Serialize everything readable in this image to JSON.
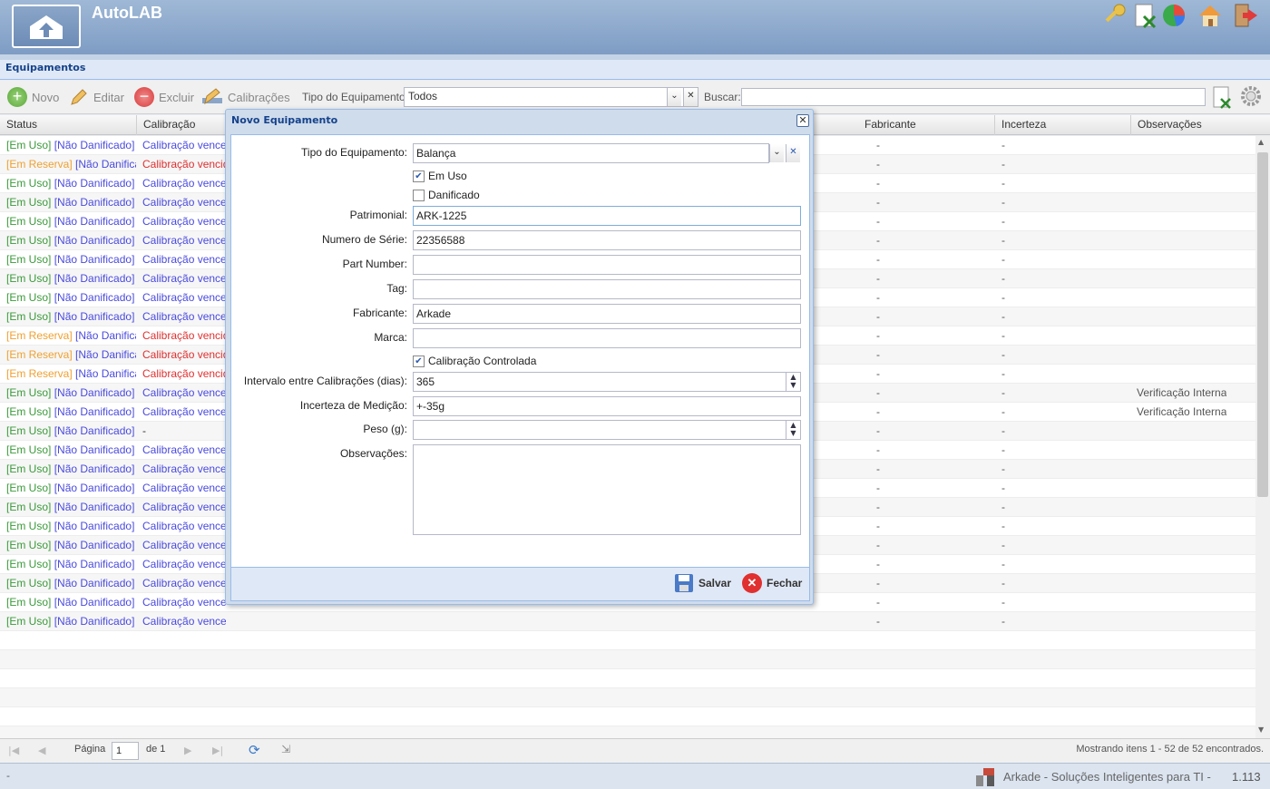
{
  "app": {
    "title": "AutoLAB"
  },
  "panel": {
    "title": "Equipamentos"
  },
  "toolbar": {
    "novo": "Novo",
    "editar": "Editar",
    "excluir": "Excluir",
    "calibracoes": "Calibrações",
    "tipo_label": "Tipo do Equipamento:",
    "tipo_value": "Todos",
    "buscar_label": "Buscar:"
  },
  "grid": {
    "headers": {
      "status": "Status",
      "calibracao": "Calibração",
      "fabricante": "Fabricante",
      "incerteza": "Incerteza",
      "observacoes": "Observações"
    },
    "rows": [
      {
        "s1": "[Em Uso]",
        "s2": "[Não Danificado]",
        "cal": "Calibração vencerá",
        "fab": "-",
        "inc": "-",
        "obs": ""
      },
      {
        "s1": "[Em Reserva]",
        "s2": "[Não Danificado]",
        "cal": "Calibração vencida",
        "fab": "-",
        "inc": "-",
        "obs": ""
      },
      {
        "s1": "[Em Uso]",
        "s2": "[Não Danificado]",
        "cal": "Calibração vencerá",
        "fab": "-",
        "inc": "-",
        "obs": ""
      },
      {
        "s1": "[Em Uso]",
        "s2": "[Não Danificado]",
        "cal": "Calibração vencerá",
        "fab": "-",
        "inc": "-",
        "obs": ""
      },
      {
        "s1": "[Em Uso]",
        "s2": "[Não Danificado]",
        "cal": "Calibração vencerá",
        "fab": "-",
        "inc": "-",
        "obs": ""
      },
      {
        "s1": "[Em Uso]",
        "s2": "[Não Danificado]",
        "cal": "Calibração vencerá",
        "fab": "-",
        "inc": "-",
        "obs": ""
      },
      {
        "s1": "[Em Uso]",
        "s2": "[Não Danificado]",
        "cal": "Calibração vencerá",
        "fab": "-",
        "inc": "-",
        "obs": ""
      },
      {
        "s1": "[Em Uso]",
        "s2": "[Não Danificado]",
        "cal": "Calibração vencerá",
        "fab": "-",
        "inc": "-",
        "obs": ""
      },
      {
        "s1": "[Em Uso]",
        "s2": "[Não Danificado]",
        "cal": "Calibração vencerá",
        "fab": "-",
        "inc": "-",
        "obs": ""
      },
      {
        "s1": "[Em Uso]",
        "s2": "[Não Danificado]",
        "cal": "Calibração vencerá",
        "fab": "-",
        "inc": "-",
        "obs": ""
      },
      {
        "s1": "[Em Reserva]",
        "s2": "[Não Danificado]",
        "cal": "Calibração vencida",
        "fab": "-",
        "inc": "-",
        "obs": ""
      },
      {
        "s1": "[Em Reserva]",
        "s2": "[Não Danificado]",
        "cal": "Calibração vencida",
        "fab": "-",
        "inc": "-",
        "obs": ""
      },
      {
        "s1": "[Em Reserva]",
        "s2": "[Não Danificado]",
        "cal": "Calibração vencida",
        "fab": "-",
        "inc": "-",
        "obs": ""
      },
      {
        "s1": "[Em Uso]",
        "s2": "[Não Danificado]",
        "cal": "Calibração vencerá",
        "fab": "-",
        "inc": "-",
        "obs": "Verificação Interna"
      },
      {
        "s1": "[Em Uso]",
        "s2": "[Não Danificado]",
        "cal": "Calibração vencerá",
        "fab": "-",
        "inc": "-",
        "obs": "Verificação Interna"
      },
      {
        "s1": "[Em Uso]",
        "s2": "[Não Danificado]",
        "cal": "-",
        "fab": "-",
        "inc": "-",
        "obs": ""
      },
      {
        "s1": "[Em Uso]",
        "s2": "[Não Danificado]",
        "cal": "Calibração vencerá",
        "fab": "-",
        "inc": "-",
        "obs": ""
      },
      {
        "s1": "[Em Uso]",
        "s2": "[Não Danificado]",
        "cal": "Calibração vencerá",
        "fab": "-",
        "inc": "-",
        "obs": ""
      },
      {
        "s1": "[Em Uso]",
        "s2": "[Não Danificado]",
        "cal": "Calibração vencerá",
        "fab": "-",
        "inc": "-",
        "obs": ""
      },
      {
        "s1": "[Em Uso]",
        "s2": "[Não Danificado]",
        "cal": "Calibração vencerá",
        "fab": "-",
        "inc": "-",
        "obs": ""
      },
      {
        "s1": "[Em Uso]",
        "s2": "[Não Danificado]",
        "cal": "Calibração vencerá",
        "fab": "-",
        "inc": "-",
        "obs": ""
      },
      {
        "s1": "[Em Uso]",
        "s2": "[Não Danificado]",
        "cal": "Calibração vencerá",
        "fab": "-",
        "inc": "-",
        "obs": ""
      },
      {
        "s1": "[Em Uso]",
        "s2": "[Não Danificado]",
        "cal": "Calibração vencerá",
        "fab": "-",
        "inc": "-",
        "obs": ""
      },
      {
        "s1": "[Em Uso]",
        "s2": "[Não Danificado]",
        "cal": "Calibração vencerá",
        "fab": "-",
        "inc": "-",
        "obs": ""
      },
      {
        "s1": "[Em Uso]",
        "s2": "[Não Danificado]",
        "cal": "Calibração vencerá",
        "fab": "-",
        "inc": "-",
        "obs": ""
      },
      {
        "s1": "[Em Uso]",
        "s2": "[Não Danificado]",
        "cal": "Calibração vencerá",
        "fab": "-",
        "inc": "-",
        "obs": ""
      }
    ]
  },
  "pager": {
    "pagina": "Página",
    "page": "1",
    "de": "de 1",
    "info": "Mostrando itens 1 - 52 de 52 encontrados."
  },
  "statusbar": {
    "left": "-",
    "company": "Arkade - Soluções Inteligentes para TI -",
    "version": "1.113"
  },
  "dialog": {
    "title": "Novo Equipamento",
    "tipo_label": "Tipo do Equipamento:",
    "tipo_value": "Balança",
    "em_uso": "Em Uso",
    "danificado": "Danificado",
    "patrimonial_label": "Patrimonial:",
    "patrimonial": "ARK-1225",
    "serie_label": "Numero de Série:",
    "serie": "22356588",
    "part_label": "Part Number:",
    "part": "",
    "tag_label": "Tag:",
    "tag": "",
    "fabricante_label": "Fabricante:",
    "fabricante": "Arkade",
    "marca_label": "Marca:",
    "marca": "",
    "calib_controlada": "Calibração Controlada",
    "intervalo_label": "Intervalo entre Calibrações (dias):",
    "intervalo": "365",
    "incerteza_label": "Incerteza de Medição:",
    "incerteza": "+-35g",
    "peso_label": "Peso (g):",
    "peso": "",
    "obs_label": "Observações:",
    "salvar": "Salvar",
    "fechar": "Fechar"
  },
  "colors": {
    "green": "#3a9a3a",
    "blue": "#4a4adf",
    "orange": "#f0a030",
    "red": "#e03030",
    "header": "#15428b"
  }
}
